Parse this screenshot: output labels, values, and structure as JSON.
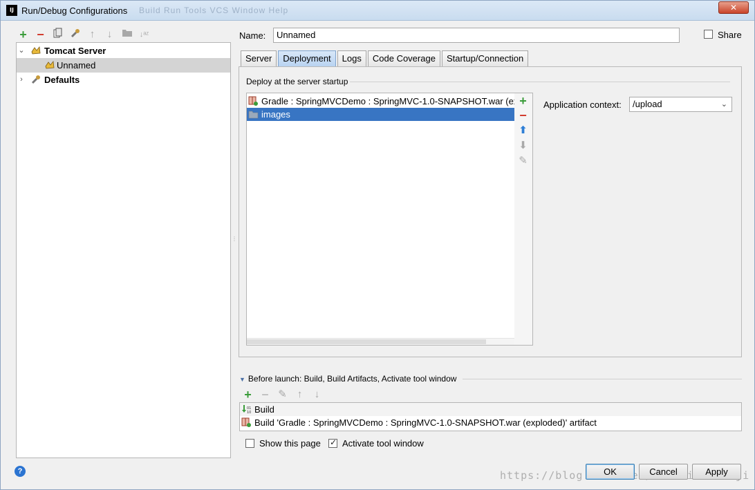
{
  "window": {
    "title": "Run/Debug Configurations",
    "app_icon": "IJ",
    "menu_ghost": "Build  Run  Tools  VCS  Window  Help",
    "close_label": "✕"
  },
  "left_toolbar": {
    "icons": [
      "add-icon",
      "remove-icon",
      "copy-icon",
      "wrench-icon",
      "move-up-icon",
      "move-down-icon",
      "folder-icon",
      "sort-icon"
    ]
  },
  "tree": {
    "items": [
      {
        "label": "Tomcat Server",
        "expanded": true,
        "icon": "tomcat-icon"
      },
      {
        "label": "Unnamed",
        "icon": "tomcat-icon",
        "selected": true
      },
      {
        "label": "Defaults",
        "expanded": false,
        "icon": "wrench-icon"
      }
    ]
  },
  "config": {
    "name_label": "Name:",
    "name_value": "Unnamed",
    "share_label": "Share",
    "share_checked": false
  },
  "tabs": [
    {
      "label": "Server",
      "active": false
    },
    {
      "label": "Deployment",
      "active": true
    },
    {
      "label": "Logs",
      "active": false
    },
    {
      "label": "Code Coverage",
      "active": false
    },
    {
      "label": "Startup/Connection",
      "active": false
    }
  ],
  "deployment": {
    "group_title": "Deploy at the server startup",
    "items": [
      {
        "label": "Gradle : SpringMVCDemo : SpringMVC-1.0-SNAPSHOT.war (ex",
        "icon": "artifact-icon",
        "selected": false
      },
      {
        "label": "images",
        "icon": "folder-icon",
        "selected": true
      }
    ],
    "context_label": "Application context:",
    "context_value": "/upload"
  },
  "before_launch": {
    "title": "Before launch: Build, Build Artifacts, Activate tool window",
    "items": [
      {
        "label": "Build",
        "icon": "build-icon"
      },
      {
        "label": "Build 'Gradle : SpringMVCDemo : SpringMVC-1.0-SNAPSHOT.war (exploded)' artifact",
        "icon": "artifact-icon"
      }
    ],
    "show_page_label": "Show this page",
    "show_page_checked": false,
    "activate_label": "Activate tool window",
    "activate_checked": true
  },
  "footer": {
    "help": "?",
    "ok": "OK",
    "cancel": "Cancel",
    "apply": "Apply",
    "watermark": "https://blog.csdn.net/shenzixincaiji"
  },
  "colors": {
    "selection": "#3875c3",
    "tab_active": "#b9d3f1",
    "add": "#3a9c3a",
    "remove": "#d13a2d"
  }
}
